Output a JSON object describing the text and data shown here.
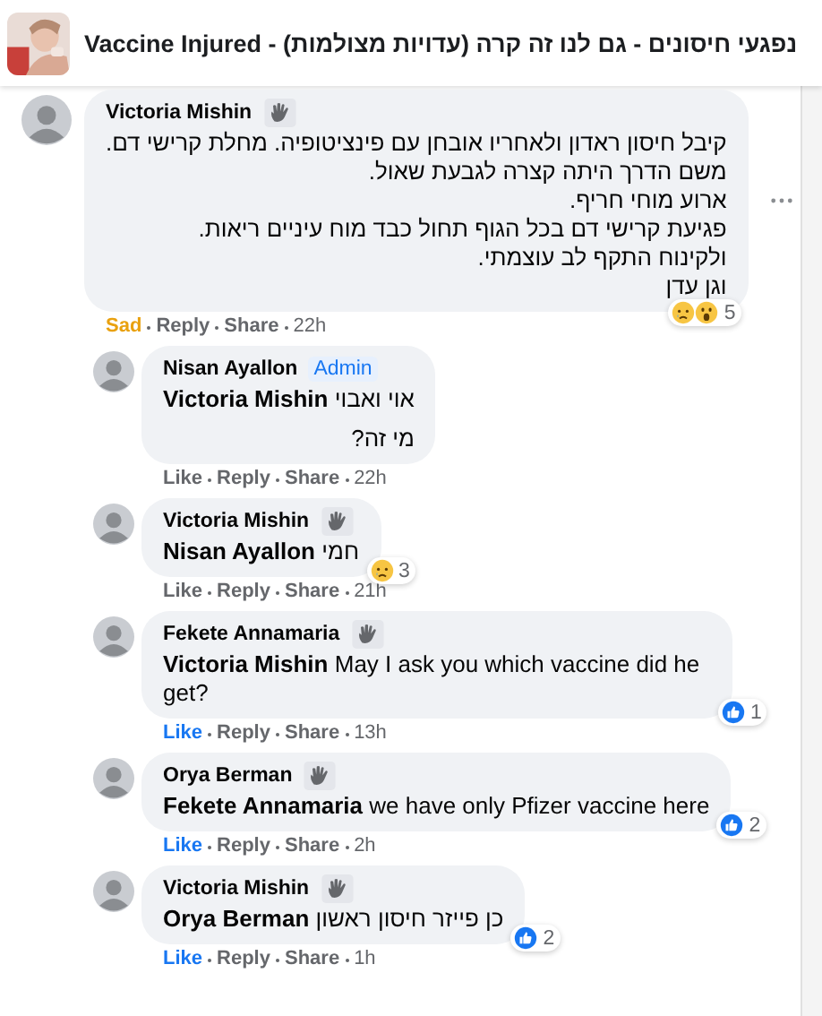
{
  "header": {
    "title": "נפגעי חיסונים - גם לנו זה קרה (עדויות מצולמות) - Vaccine Injured"
  },
  "comments": [
    {
      "author": "Victoria Mishin",
      "badge": {
        "kind": "icon"
      },
      "paragraphs": [
        {
          "text": "קיבל חיסון ראדון ולאחריו אובחן עם פינציטופיה. מחלת קרישי דם.\nמשם הדרך היתה קצרה לגבעת שאול.\nארוע מוחי חריף.\nפגיעת קרישי דם בכל הגוף תחול כבד מוח עיניים ריאות.\nולקינוח התקף לב עוצמתי.\nוגן עדן"
        }
      ],
      "reactions": [
        {
          "kind": "sad"
        },
        {
          "kind": "wow"
        }
      ],
      "reaction_count": "5",
      "reaction": {
        "label": "Sad",
        "kind": "sad",
        "selected": true
      },
      "links": [
        "Reply",
        "Share"
      ],
      "time": "22h",
      "more": true,
      "children": [
        {
          "author": "Nisan Ayallon",
          "badge": {
            "kind": "label",
            "text": "Admin"
          },
          "paragraphs": [
            {
              "mention": "Victoria Mishin",
              "text": "אוי ואבוי"
            },
            {
              "text": "מי זה?"
            }
          ],
          "reaction": {
            "label": "Like",
            "selected": false
          },
          "links": [
            "Reply",
            "Share"
          ],
          "time": "22h"
        },
        {
          "author": "Victoria Mishin",
          "badge": {
            "kind": "icon"
          },
          "paragraphs": [
            {
              "mention": "Nisan Ayallon",
              "text": "חמי"
            }
          ],
          "reactions": [
            {
              "kind": "sad"
            }
          ],
          "reaction_count": "3",
          "reaction": {
            "label": "Like",
            "selected": false
          },
          "links": [
            "Reply",
            "Share"
          ],
          "time": "21h"
        },
        {
          "author": "Fekete Annamaria",
          "badge": {
            "kind": "icon"
          },
          "paragraphs": [
            {
              "mention": "Victoria Mishin",
              "text": "May I ask you which vaccine did he get?"
            }
          ],
          "reactions": [
            {
              "kind": "like"
            }
          ],
          "reaction_count": "1",
          "reaction": {
            "label": "Like",
            "selected": true
          },
          "links": [
            "Reply",
            "Share"
          ],
          "time": "13h"
        },
        {
          "author": "Orya Berman",
          "badge": {
            "kind": "icon"
          },
          "paragraphs": [
            {
              "mention": "Fekete Annamaria",
              "text": "we have only Pfizer vaccine here"
            }
          ],
          "reactions": [
            {
              "kind": "like"
            }
          ],
          "reaction_count": "2",
          "reaction": {
            "label": "Like",
            "selected": true
          },
          "links": [
            "Reply",
            "Share"
          ],
          "time": "2h"
        },
        {
          "author": "Victoria Mishin",
          "badge": {
            "kind": "icon"
          },
          "paragraphs": [
            {
              "mention": "Orya Berman",
              "text": "כן פייזר חיסון ראשון"
            }
          ],
          "reactions": [
            {
              "kind": "like"
            }
          ],
          "reaction_count": "2",
          "reaction": {
            "label": "Like",
            "selected": true
          },
          "links": [
            "Reply",
            "Share"
          ],
          "time": "1h"
        }
      ]
    }
  ]
}
